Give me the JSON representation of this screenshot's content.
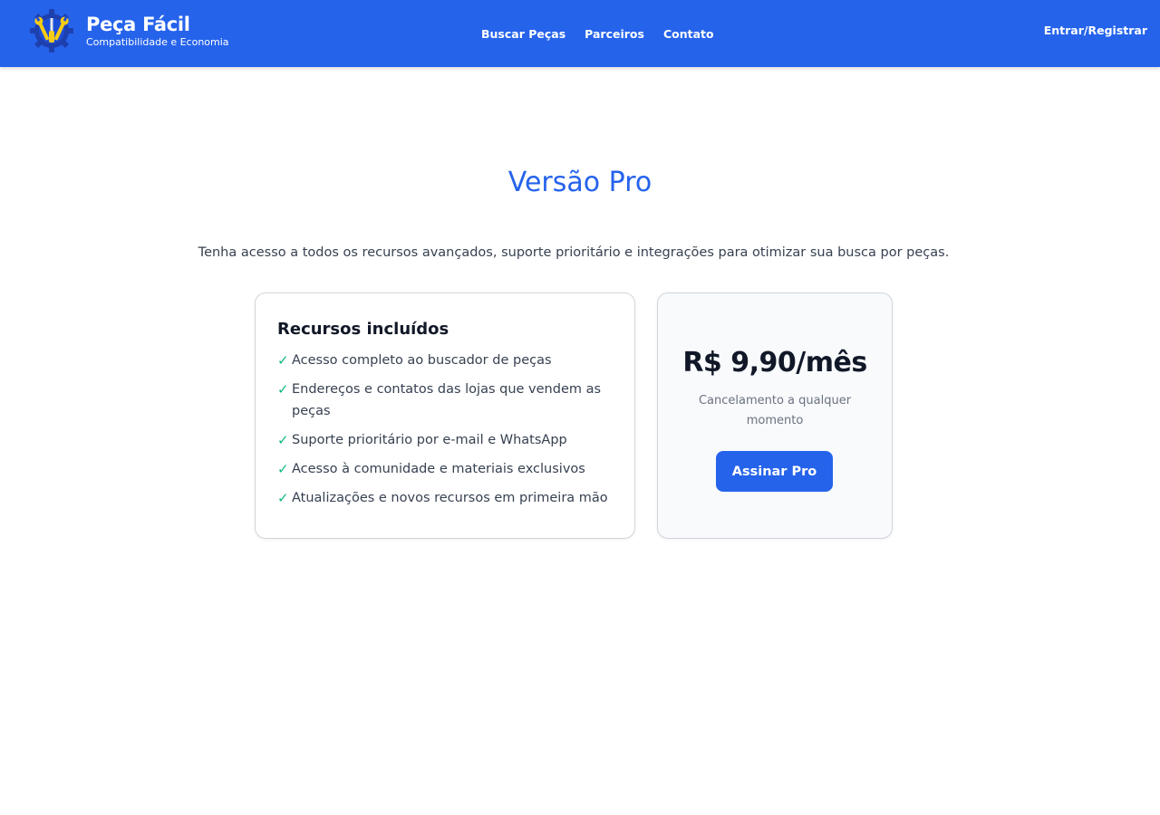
{
  "header": {
    "brand_name": "Peça Fácil",
    "brand_tagline": "Compatibilidade e Economia",
    "logo_icon": "gear-wrench-tools-icon",
    "nav": [
      {
        "label": "Buscar Peças"
      },
      {
        "label": "Parceiros"
      },
      {
        "label": "Contato"
      }
    ],
    "login_label": "Entrar/Registrar"
  },
  "main": {
    "title": "Versão Pro",
    "description": "Tenha acesso a todos os recursos avançados, suporte prioritário e integrações para otimizar sua busca por peças.",
    "features_card": {
      "heading": "Recursos incluídos",
      "check_icon": "check-icon",
      "check_symbol": "✓",
      "items": [
        {
          "label": "Acesso completo ao buscador de peças"
        },
        {
          "label": "Endereços e contatos das lojas que vendem as peças"
        },
        {
          "label": "Suporte prioritário por e-mail e WhatsApp"
        },
        {
          "label": "Acesso à comunidade e materiais exclusivos"
        },
        {
          "label": "Atualizações e novos recursos em primeira mão"
        }
      ]
    },
    "price_card": {
      "price": "R$ 9,90/mês",
      "note": "Cancelamento a qualquer momento",
      "button_label": "Assinar Pro"
    }
  },
  "colors": {
    "primary": "#2563eb",
    "check": "#10b981",
    "logo_gear": "#1e3a8a",
    "logo_accent": "#facc15"
  }
}
